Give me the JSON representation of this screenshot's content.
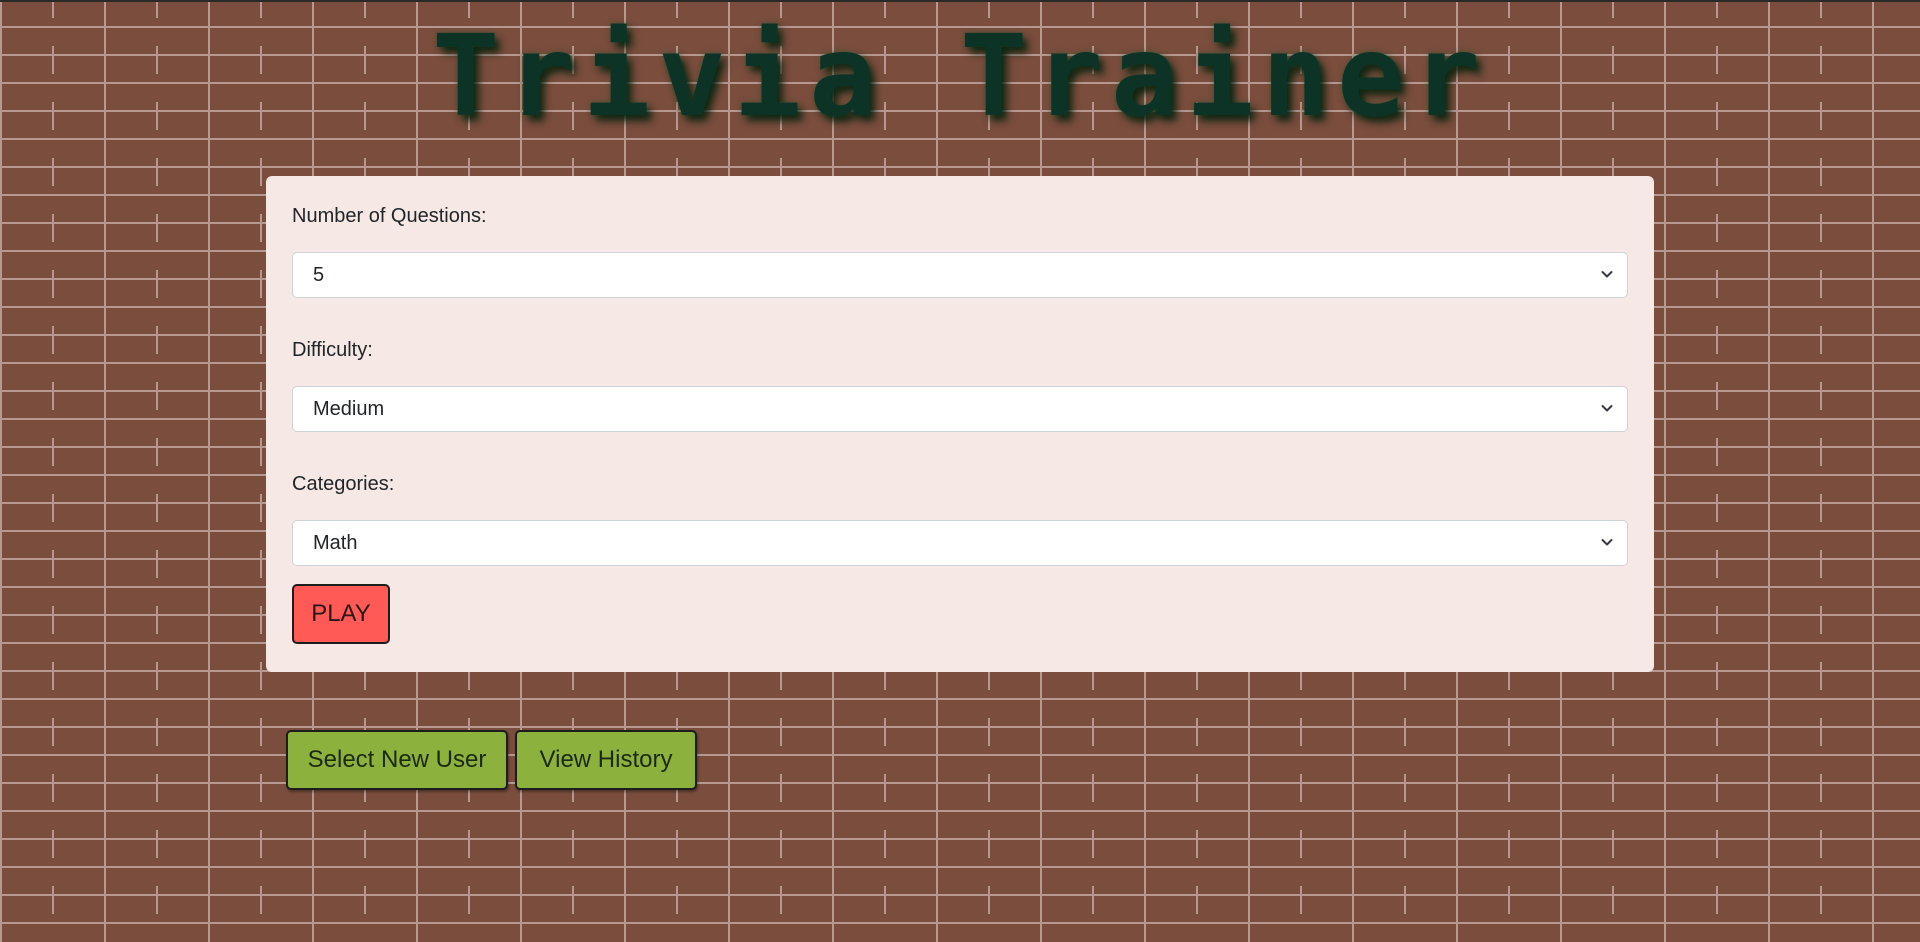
{
  "app": {
    "title": "Trivia Trainer"
  },
  "form": {
    "questions": {
      "label": "Number of Questions:",
      "selected": "5"
    },
    "difficulty": {
      "label": "Difficulty:",
      "selected": "Medium"
    },
    "categories": {
      "label": "Categories:",
      "selected": "Math"
    },
    "play_label": "PLAY"
  },
  "actions": {
    "select_user_label": "Select New User",
    "view_history_label": "View History"
  },
  "colors": {
    "background_brick": "#7a4d3d",
    "mortar": "#b79891",
    "title": "#0d3326",
    "card": "#f5e8e5",
    "play_button": "#ff5a56",
    "action_button": "#8cb13c"
  },
  "icons": {
    "select_chevron": "chevron-down-icon"
  }
}
